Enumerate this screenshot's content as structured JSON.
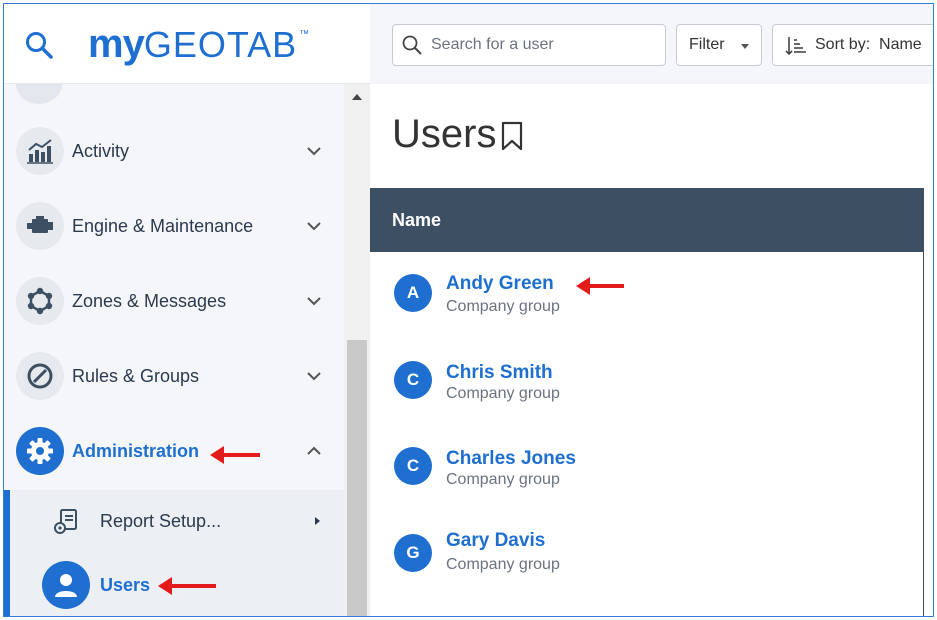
{
  "brand": {
    "logo_bold": "my",
    "logo_light": "GEOTAB",
    "logo_tm": "™"
  },
  "sidebar": {
    "items": [
      {
        "label": "Activity",
        "icon": "activity-chart-icon",
        "expanded": false
      },
      {
        "label": "Engine & Maintenance",
        "icon": "engine-icon",
        "expanded": false
      },
      {
        "label": "Zones & Messages",
        "icon": "zones-icon",
        "expanded": false
      },
      {
        "label": "Rules & Groups",
        "icon": "rules-icon",
        "expanded": false
      },
      {
        "label": "Administration",
        "icon": "gear-icon",
        "expanded": true
      }
    ],
    "subitems": [
      {
        "label": "Report Setup...",
        "icon": "report-setup-icon"
      },
      {
        "label": "Users",
        "icon": "user-icon"
      }
    ]
  },
  "toolbar": {
    "search_placeholder": "Search for a user",
    "filter_label": "Filter",
    "sort_label": "Sort by:  Name"
  },
  "page": {
    "title": "Users"
  },
  "table": {
    "header": "Name",
    "rows": [
      {
        "initial": "A",
        "name": "Andy Green",
        "group": "Company group"
      },
      {
        "initial": "C",
        "name": "Chris Smith",
        "group": "Company group"
      },
      {
        "initial": "C",
        "name": "Charles Jones",
        "group": "Company group"
      },
      {
        "initial": "G",
        "name": "Gary Davis",
        "group": "Company group"
      }
    ]
  },
  "colors": {
    "accent": "#1e6fd0",
    "header_bg": "#3c4f63",
    "annotation_arrow": "#e41b1b"
  }
}
